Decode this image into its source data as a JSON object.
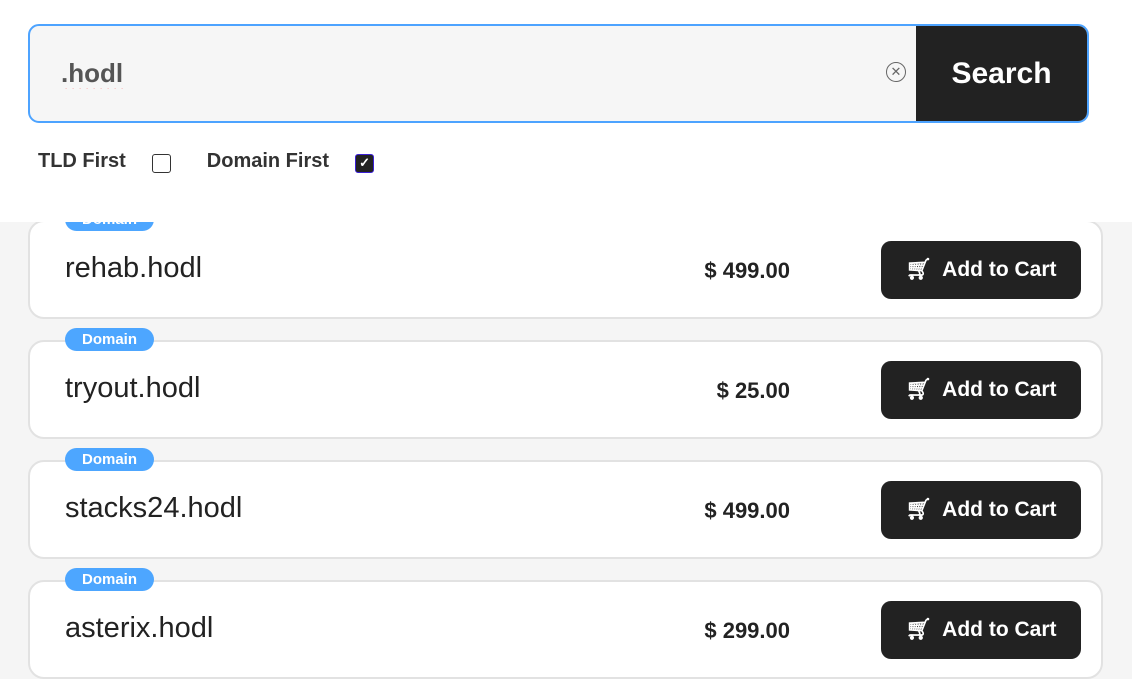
{
  "search": {
    "value": ".hodl",
    "button_label": "Search"
  },
  "options": {
    "tld_first_label": "TLD First",
    "tld_first_checked": false,
    "domain_first_label": "Domain First",
    "domain_first_checked": true
  },
  "results": [
    {
      "badge": "Domain",
      "name": "rehab.hodl",
      "price": "$ 499.00",
      "button": "Add to Cart"
    },
    {
      "badge": "Domain",
      "name": "tryout.hodl",
      "price": "$ 25.00",
      "button": "Add to Cart"
    },
    {
      "badge": "Domain",
      "name": "stacks24.hodl",
      "price": "$ 499.00",
      "button": "Add to Cart"
    },
    {
      "badge": "Domain",
      "name": "asterix.hodl",
      "price": "$ 299.00",
      "button": "Add to Cart"
    }
  ]
}
